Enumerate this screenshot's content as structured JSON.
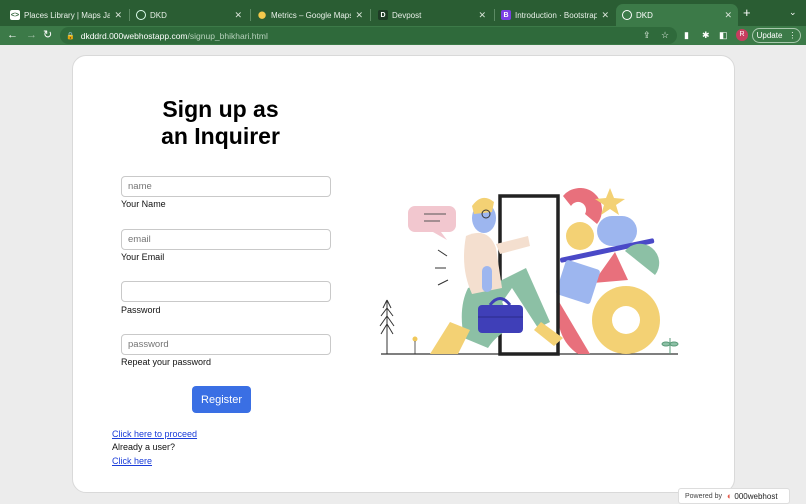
{
  "browser": {
    "tabs": [
      {
        "title": "Places Library | Maps JavaS",
        "favicon": "maps-icon",
        "active": false
      },
      {
        "title": "DKD",
        "favicon": "globe-icon",
        "active": false
      },
      {
        "title": "Metrics – Google Maps Plat",
        "favicon": "map-pin-icon",
        "active": false
      },
      {
        "title": "Devpost",
        "favicon": "devpost-icon",
        "active": false
      },
      {
        "title": "Introduction · Bootstrap",
        "favicon": "bootstrap-icon",
        "active": false
      },
      {
        "title": "DKD",
        "favicon": "globe-icon",
        "active": true
      }
    ],
    "url_domain": "dkddrd.000webhostapp.com",
    "url_path": "/signup_bhikhari.html",
    "profile_initial": "R",
    "update_label": "Update"
  },
  "page": {
    "heading": "Sign up as an Inquirer",
    "fields": [
      {
        "placeholder": "name",
        "label": "Your Name",
        "type": "text"
      },
      {
        "placeholder": "email",
        "label": "Your Email",
        "type": "text"
      },
      {
        "placeholder": "",
        "label": "Password",
        "type": "password"
      },
      {
        "placeholder": "password",
        "label": "Repeat your password",
        "type": "password"
      }
    ],
    "register_label": "Register",
    "proceed_link": "Click here to proceed",
    "already_user": "Already a user?",
    "login_link": "Click here"
  },
  "footer": {
    "powered_by": "Powered by",
    "brand": "000webhost"
  },
  "colors": {
    "tab_strip": "#2a5d33",
    "toolbar": "#3c7a48",
    "primary_button": "#3a6fe4",
    "link": "#1a3cd9"
  }
}
